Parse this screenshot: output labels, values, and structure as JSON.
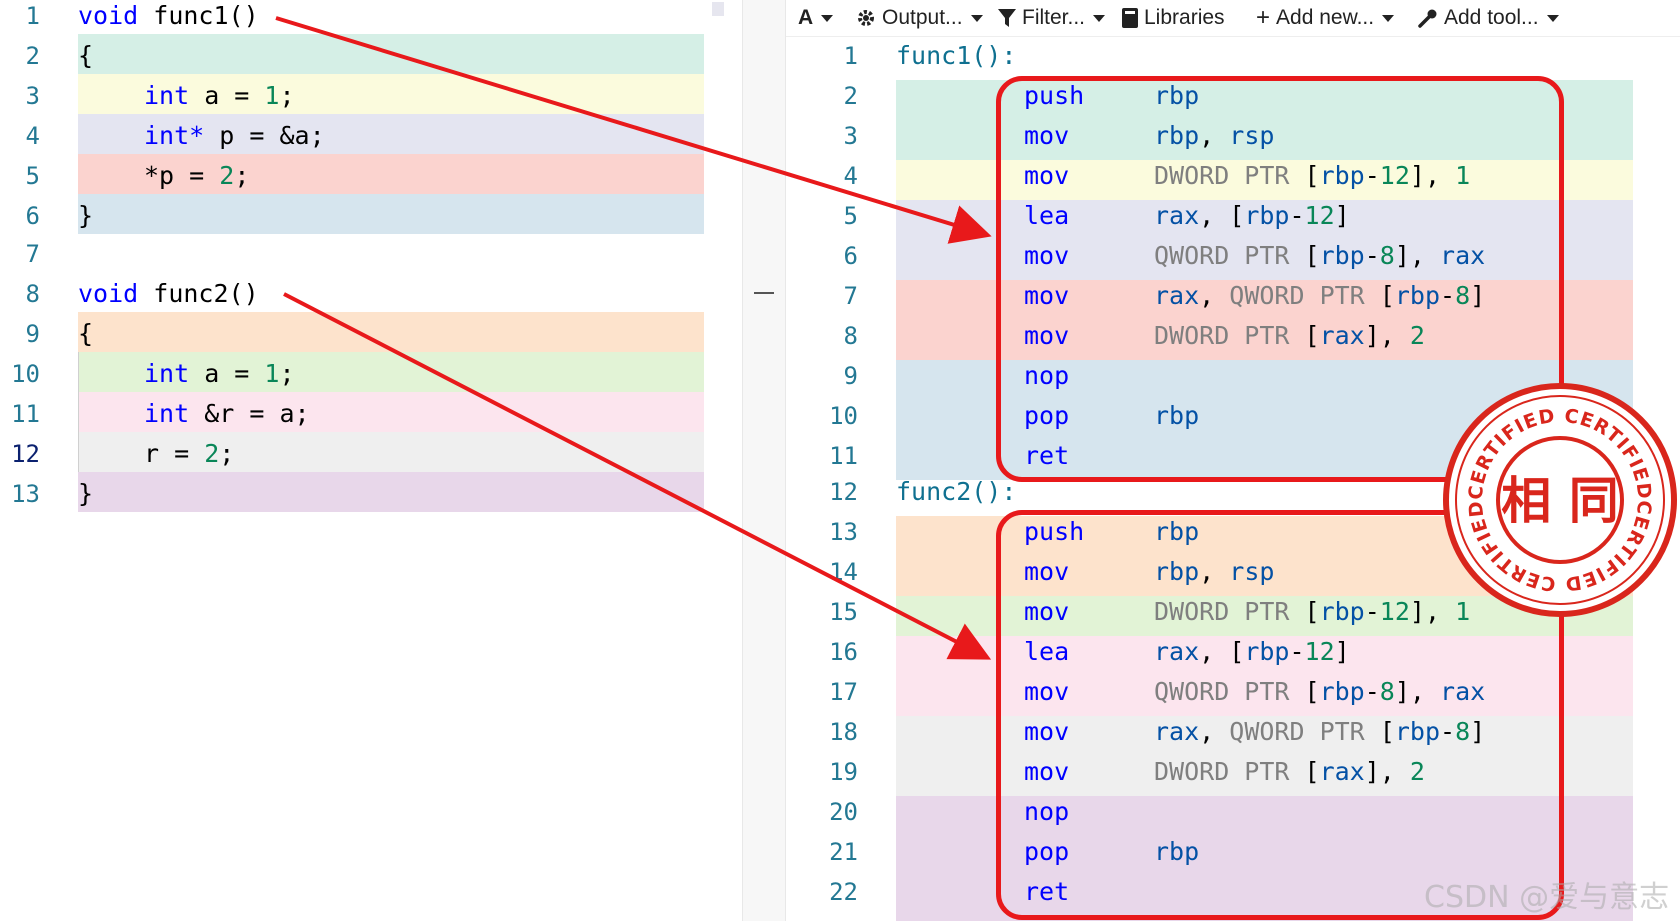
{
  "source_editor": {
    "lines": [
      {
        "num": "1",
        "text": "void func1()"
      },
      {
        "num": "2",
        "text": "{"
      },
      {
        "num": "3",
        "text": "int a = 1;"
      },
      {
        "num": "4",
        "text": "int* p = &a;"
      },
      {
        "num": "5",
        "text": "*p = 2;"
      },
      {
        "num": "6",
        "text": "}"
      },
      {
        "num": "7",
        "text": ""
      },
      {
        "num": "8",
        "text": "void func2()"
      },
      {
        "num": "9",
        "text": "{"
      },
      {
        "num": "10",
        "text": "int a = 1;"
      },
      {
        "num": "11",
        "text": "int &r = a;"
      },
      {
        "num": "12",
        "text": "r = 2;"
      },
      {
        "num": "13",
        "text": "}"
      }
    ],
    "tokens": {
      "void": "void",
      "func1": "func1()",
      "func2": "func2()",
      "open": "{",
      "close": "}",
      "int": "int",
      "int_ptr": "int*",
      "int_ref": "int",
      "a_eq": " a = ",
      "one": "1",
      "semi": ";",
      "p_eq": " p = &a;",
      "star_p": "*p = ",
      "two": "2",
      "r_eq": " &r = a;",
      "r": "r = "
    }
  },
  "toolbar": {
    "font_label": "A",
    "output_label": "Output...",
    "filter_label": "Filter...",
    "libraries_label": "Libraries",
    "add_new_label": "Add new...",
    "add_tool_label": "Add tool..."
  },
  "asm": {
    "lines": [
      {
        "num": "1",
        "label": "func1():"
      },
      {
        "num": "2",
        "op": "push",
        "args": [
          [
            "reg",
            "rbp"
          ]
        ]
      },
      {
        "num": "3",
        "op": "mov",
        "args": [
          [
            "reg",
            "rbp"
          ],
          [
            "p",
            ", "
          ],
          [
            "reg",
            "rsp"
          ]
        ]
      },
      {
        "num": "4",
        "op": "mov",
        "args": [
          [
            "ptr",
            "DWORD PTR "
          ],
          [
            "p",
            "["
          ],
          [
            "reg",
            "rbp"
          ],
          [
            "p",
            "-"
          ],
          [
            "num",
            "12"
          ],
          [
            "p",
            "], "
          ],
          [
            "num",
            "1"
          ]
        ]
      },
      {
        "num": "5",
        "op": "lea",
        "args": [
          [
            "reg",
            "rax"
          ],
          [
            "p",
            ", ["
          ],
          [
            "reg",
            "rbp"
          ],
          [
            "p",
            "-"
          ],
          [
            "num",
            "12"
          ],
          [
            "p",
            "]"
          ]
        ]
      },
      {
        "num": "6",
        "op": "mov",
        "args": [
          [
            "ptr",
            "QWORD PTR "
          ],
          [
            "p",
            "["
          ],
          [
            "reg",
            "rbp"
          ],
          [
            "p",
            "-"
          ],
          [
            "num",
            "8"
          ],
          [
            "p",
            "], "
          ],
          [
            "reg",
            "rax"
          ]
        ]
      },
      {
        "num": "7",
        "op": "mov",
        "args": [
          [
            "reg",
            "rax"
          ],
          [
            "p",
            ", "
          ],
          [
            "ptr",
            "QWORD PTR "
          ],
          [
            "p",
            "["
          ],
          [
            "reg",
            "rbp"
          ],
          [
            "p",
            "-"
          ],
          [
            "num",
            "8"
          ],
          [
            "p",
            "]"
          ]
        ]
      },
      {
        "num": "8",
        "op": "mov",
        "args": [
          [
            "ptr",
            "DWORD PTR "
          ],
          [
            "p",
            "["
          ],
          [
            "reg",
            "rax"
          ],
          [
            "p",
            "], "
          ],
          [
            "num",
            "2"
          ]
        ]
      },
      {
        "num": "9",
        "op": "nop",
        "args": []
      },
      {
        "num": "10",
        "op": "pop",
        "args": [
          [
            "reg",
            "rbp"
          ]
        ]
      },
      {
        "num": "11",
        "op": "ret",
        "args": []
      },
      {
        "num": "12",
        "label": "func2():"
      },
      {
        "num": "13",
        "op": "push",
        "args": [
          [
            "reg",
            "rbp"
          ]
        ]
      },
      {
        "num": "14",
        "op": "mov",
        "args": [
          [
            "reg",
            "rbp"
          ],
          [
            "p",
            ", "
          ],
          [
            "reg",
            "rsp"
          ]
        ]
      },
      {
        "num": "15",
        "op": "mov",
        "args": [
          [
            "ptr",
            "DWORD PTR "
          ],
          [
            "p",
            "["
          ],
          [
            "reg",
            "rbp"
          ],
          [
            "p",
            "-"
          ],
          [
            "num",
            "12"
          ],
          [
            "p",
            "], "
          ],
          [
            "num",
            "1"
          ]
        ]
      },
      {
        "num": "16",
        "op": "lea",
        "args": [
          [
            "reg",
            "rax"
          ],
          [
            "p",
            ", ["
          ],
          [
            "reg",
            "rbp"
          ],
          [
            "p",
            "-"
          ],
          [
            "num",
            "12"
          ],
          [
            "p",
            "]"
          ]
        ]
      },
      {
        "num": "17",
        "op": "mov",
        "args": [
          [
            "ptr",
            "QWORD PTR "
          ],
          [
            "p",
            "["
          ],
          [
            "reg",
            "rbp"
          ],
          [
            "p",
            "-"
          ],
          [
            "num",
            "8"
          ],
          [
            "p",
            "], "
          ],
          [
            "reg",
            "rax"
          ]
        ]
      },
      {
        "num": "18",
        "op": "mov",
        "args": [
          [
            "reg",
            "rax"
          ],
          [
            "p",
            ", "
          ],
          [
            "ptr",
            "QWORD PTR "
          ],
          [
            "p",
            "["
          ],
          [
            "reg",
            "rbp"
          ],
          [
            "p",
            "-"
          ],
          [
            "num",
            "8"
          ],
          [
            "p",
            "]"
          ]
        ]
      },
      {
        "num": "19",
        "op": "mov",
        "args": [
          [
            "ptr",
            "DWORD PTR "
          ],
          [
            "p",
            "["
          ],
          [
            "reg",
            "rax"
          ],
          [
            "p",
            "], "
          ],
          [
            "num",
            "2"
          ]
        ]
      },
      {
        "num": "20",
        "op": "nop",
        "args": []
      },
      {
        "num": "21",
        "op": "pop",
        "args": [
          [
            "reg",
            "rbp"
          ]
        ]
      },
      {
        "num": "22",
        "op": "ret",
        "args": []
      }
    ]
  },
  "stamp": {
    "main_text": "相 同",
    "ring_text": "CERTIFIED CERTIFIED",
    "color": "#d9261c"
  },
  "watermark": "CSDN @爱与意志",
  "colors": {
    "teal": "#d5efe6",
    "yellow": "#fbfbdd",
    "lavender": "#e4e5f1",
    "red": "#fbd3cf",
    "blue": "#d6e5ee",
    "orange": "#fde3cc",
    "green": "#e2f3d6",
    "pink": "#fce5ee",
    "gray": "#efefef",
    "purple": "#e8d7ea",
    "annotation_red": "#e8191b"
  }
}
